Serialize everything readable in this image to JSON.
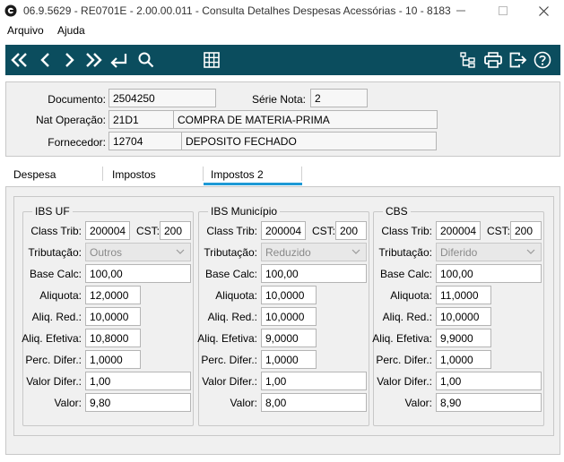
{
  "window": {
    "title": "06.9.5629 - RE0701E - 2.00.00.011 - Consulta Detalhes Despesas Acessórias - 10 - 8183"
  },
  "menu": {
    "items": [
      "Arquivo",
      "Ajuda"
    ]
  },
  "toolbar": {
    "buttons": [
      "first-icon",
      "previous-icon",
      "next-icon",
      "last-icon",
      "goto-icon",
      "search-icon",
      "grid-icon",
      "hierarchy-icon",
      "print-icon",
      "exit-icon",
      "help-icon"
    ],
    "accent": "#0b4d5e"
  },
  "header": {
    "documento_label": "Documento:",
    "documento_value": "2504250",
    "serie_label": "Série Nota:",
    "serie_value": "2",
    "natop_label": "Nat Operação:",
    "natop_code": "21D1",
    "natop_desc": "COMPRA DE MATERIA-PRIMA",
    "fornecedor_label": "Fornecedor:",
    "fornecedor_code": "12704",
    "fornecedor_desc": "DEPOSITO FECHADO"
  },
  "tabs": {
    "items": [
      "Despesa",
      "Impostos",
      "Impostos 2"
    ],
    "active": "Impostos 2",
    "active_color": "#1e9ad6"
  },
  "labels": {
    "class_trib": "Class Trib:",
    "cst": "CST:",
    "tributacao": "Tributação:",
    "base_calc": "Base Calc:",
    "aliquota": "Aliquota:",
    "aliq_red": "Aliq. Red.:",
    "aliq_efetiva": "Aliq. Efetiva:",
    "perc_difer": "Perc. Difer.:",
    "valor_difer": "Valor Difer.:",
    "valor": "Valor:"
  },
  "groups": [
    {
      "title": "IBS UF",
      "class_trib": "200004",
      "cst": "200",
      "tributacao": "Outros",
      "base_calc": "100,00",
      "aliquota": "12,0000",
      "aliq_red": "10,0000",
      "aliq_efetiva": "10,8000",
      "perc_difer": "1,0000",
      "valor_difer": "1,00",
      "valor": "9,80"
    },
    {
      "title": "IBS Município",
      "class_trib": "200004",
      "cst": "200",
      "tributacao": "Reduzido",
      "base_calc": "100,00",
      "aliquota": "10,0000",
      "aliq_red": "10,0000",
      "aliq_efetiva": "9,0000",
      "perc_difer": "1,0000",
      "valor_difer": "1,00",
      "valor": "8,00"
    },
    {
      "title": "CBS",
      "class_trib": "200004",
      "cst": "200",
      "tributacao": "Diferido",
      "base_calc": "100,00",
      "aliquota": "11,0000",
      "aliq_red": "10,0000",
      "aliq_efetiva": "9,9000",
      "perc_difer": "1,0000",
      "valor_difer": "1,00",
      "valor": "8,90"
    }
  ]
}
